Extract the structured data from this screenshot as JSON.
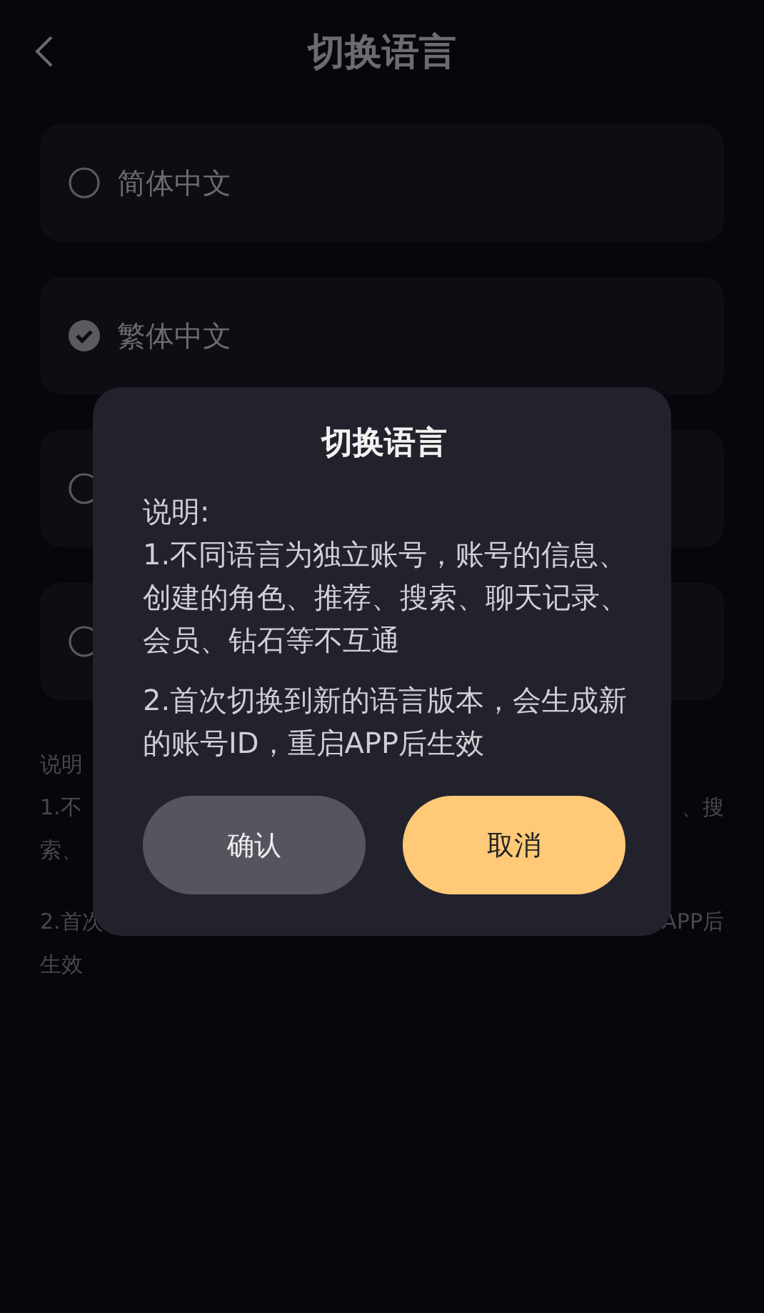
{
  "header": {
    "title": "切换语言"
  },
  "languages": [
    {
      "label": "简体中文",
      "selected": false
    },
    {
      "label": "繁体中文",
      "selected": true
    },
    {
      "selected": false
    },
    {
      "selected": false
    }
  ],
  "notes": [
    {
      "left": "说明"
    },
    {
      "left": "1.不",
      "right": "、搜"
    },
    {
      "left": "索、"
    },
    {
      "left": "2.首次",
      "right": "APP后"
    },
    {
      "left": "生效"
    }
  ],
  "dialog": {
    "title": "切换语言",
    "heading": "说明:",
    "paragraphs": [
      "1.不同语言为独立账号，账号的信息、创建的角色、推荐、搜索、聊天记录、会员、钻石等不互通",
      "2.首次切换到新的语言版本，会生成新的账号ID，重启APP后生效"
    ],
    "buttons": [
      {
        "label": "确认",
        "kind": "secondary"
      },
      {
        "label": "取消",
        "kind": "primary"
      }
    ]
  }
}
